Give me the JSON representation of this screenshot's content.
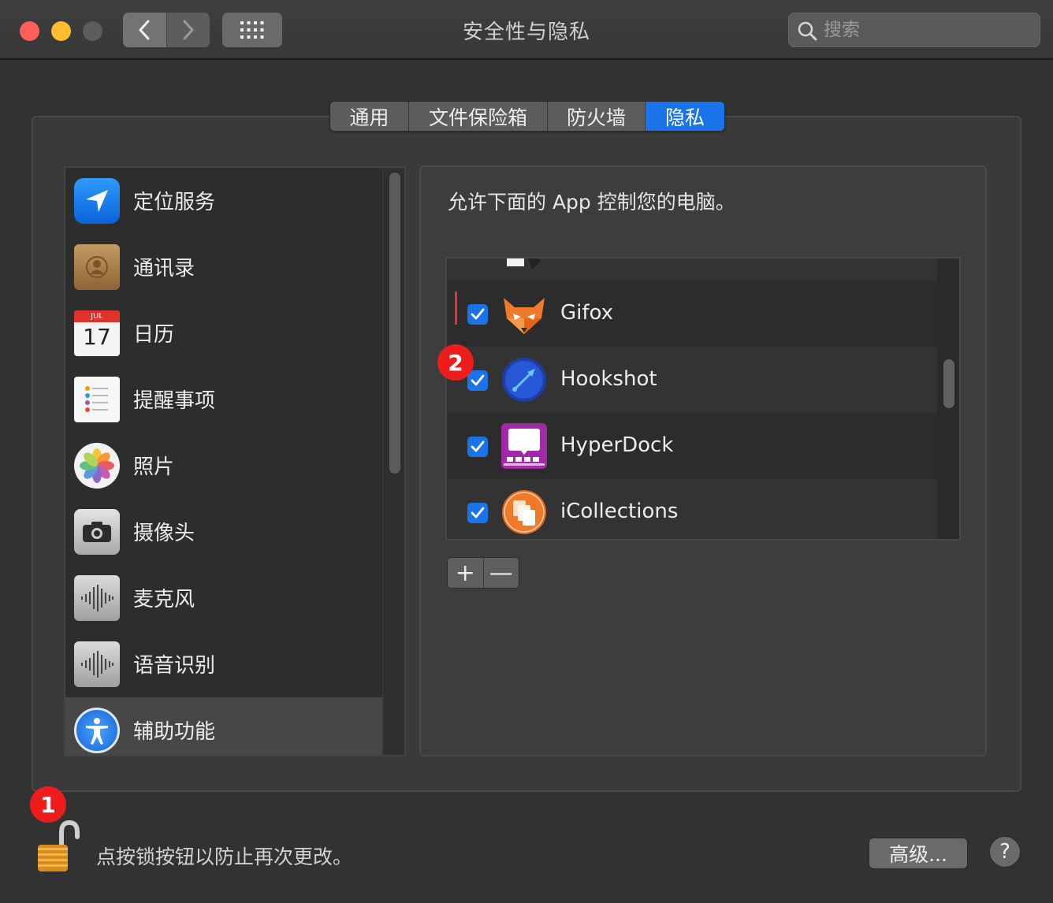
{
  "window": {
    "title": "安全性与隐私"
  },
  "search": {
    "placeholder": "搜索"
  },
  "tabs": [
    {
      "label": "通用",
      "active": false
    },
    {
      "label": "文件保险箱",
      "active": false
    },
    {
      "label": "防火墙",
      "active": false
    },
    {
      "label": "隐私",
      "active": true
    }
  ],
  "sidebar": {
    "items": [
      {
        "label": "定位服务",
        "icon": "location-arrow-icon"
      },
      {
        "label": "通讯录",
        "icon": "contacts-book-icon"
      },
      {
        "label": "日历",
        "icon": "calendar-icon",
        "month": "JUL",
        "day": "17"
      },
      {
        "label": "提醒事项",
        "icon": "reminders-list-icon"
      },
      {
        "label": "照片",
        "icon": "photos-flower-icon"
      },
      {
        "label": "摄像头",
        "icon": "camera-icon"
      },
      {
        "label": "麦克风",
        "icon": "microphone-waveform-icon"
      },
      {
        "label": "语音识别",
        "icon": "speech-waveform-icon"
      },
      {
        "label": "辅助功能",
        "icon": "accessibility-icon",
        "selected": true
      }
    ]
  },
  "panel": {
    "title": "允许下面的 App 控制您的电脑。",
    "apps": [
      {
        "name": "Gifox",
        "checked": true,
        "icon": "gifox-fox-icon"
      },
      {
        "name": "Hookshot",
        "checked": true,
        "icon": "hookshot-icon"
      },
      {
        "name": "HyperDock",
        "checked": true,
        "icon": "hyperdock-icon"
      },
      {
        "name": "iCollections",
        "checked": true,
        "icon": "icollections-icon"
      }
    ],
    "add_label": "+",
    "remove_label": "—"
  },
  "badges": {
    "first": "1",
    "second": "2"
  },
  "footer": {
    "lock_text": "点按锁按钮以防止再次更改。",
    "advanced_label": "高级...",
    "help_label": "?"
  },
  "colors": {
    "accent": "#1a73e8",
    "badge": "#ee1d1d",
    "background": "#323232"
  }
}
